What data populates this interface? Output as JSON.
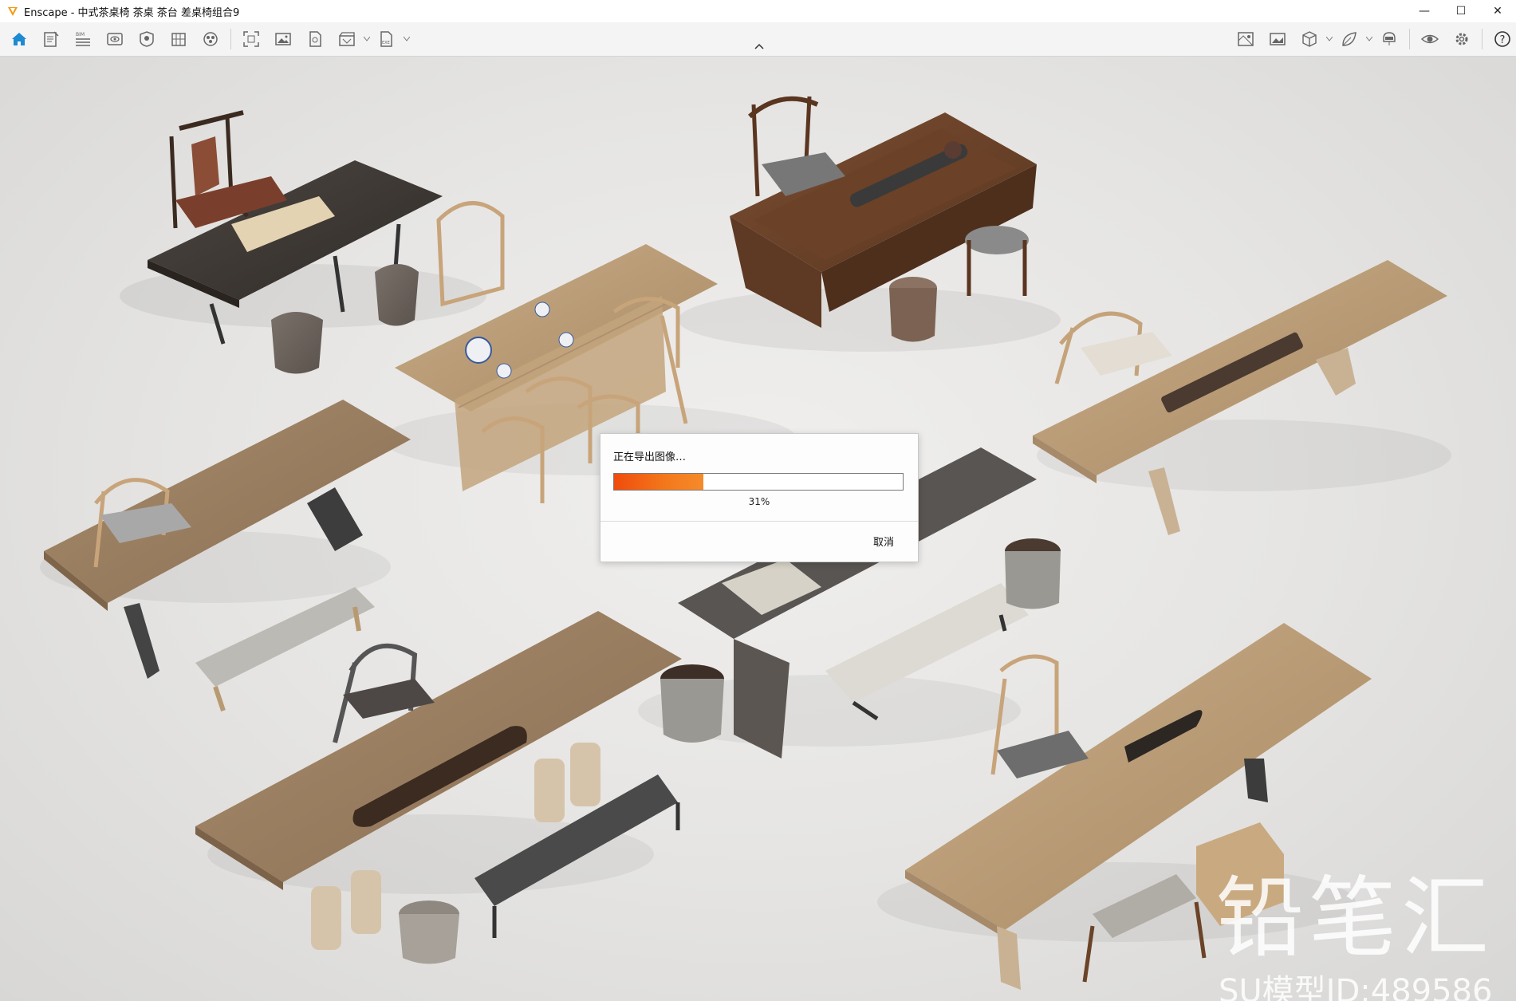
{
  "window": {
    "title": "Enscape - 中式茶桌椅 茶桌 茶台 差桌椅组合9",
    "minimize": "—",
    "maximize": "☐",
    "close": "✕"
  },
  "toolbar": {
    "left_icons": [
      "home-icon",
      "project-info-icon",
      "bim-icon",
      "visual-settings-icon",
      "asset-library-icon",
      "material-editor-icon",
      "sun-atmosphere-icon",
      "screenshot-icon",
      "render-image-icon",
      "render-panorama-icon",
      "render-video-icon",
      "export-exe-icon"
    ],
    "right_icons": [
      "site-context-icon",
      "batch-render-icon",
      "view-management-icon",
      "feedback-icon",
      "vr-headset-icon",
      "visibility-icon",
      "settings-icon",
      "help-icon"
    ],
    "help_label": "?"
  },
  "dialog": {
    "message": "正在导出图像…",
    "progress_percent": 31,
    "progress_label": "31%",
    "cancel_label": "取消"
  },
  "watermark": {
    "brand": "铅笔汇",
    "model_id": "SU模型ID:489586"
  },
  "colors": {
    "accent": "#1e8ad2",
    "progress": "#f04c0c",
    "background": "#e6e5e3"
  }
}
